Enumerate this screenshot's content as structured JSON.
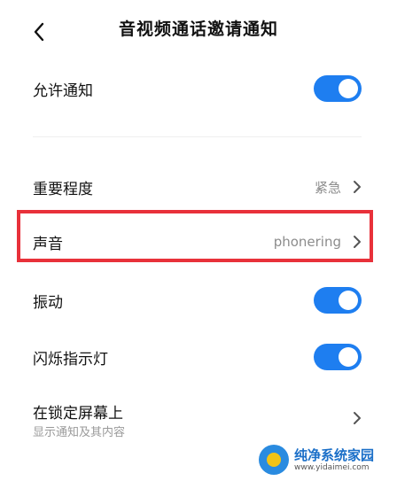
{
  "header": {
    "title": "音视频通话邀请通知",
    "back_icon": "chevron-left-icon"
  },
  "settings": {
    "allow_notifications": {
      "label": "允许通知",
      "enabled": true
    },
    "importance": {
      "label": "重要程度",
      "value": "紧急"
    },
    "sound": {
      "label": "声音",
      "value": "phonering"
    },
    "vibration": {
      "label": "振动",
      "enabled": true
    },
    "flash_light": {
      "label": "闪烁指示灯",
      "enabled": true
    },
    "lock_screen": {
      "label": "在锁定屏幕上",
      "sublabel": "显示通知及其内容"
    }
  },
  "watermark": {
    "name": "纯净系统家园",
    "url": "www.yidaimei.com"
  },
  "colors": {
    "toggle_on": "#1e7ef0",
    "highlight_border": "#e8313a",
    "secondary_text": "#8c8c8c"
  }
}
